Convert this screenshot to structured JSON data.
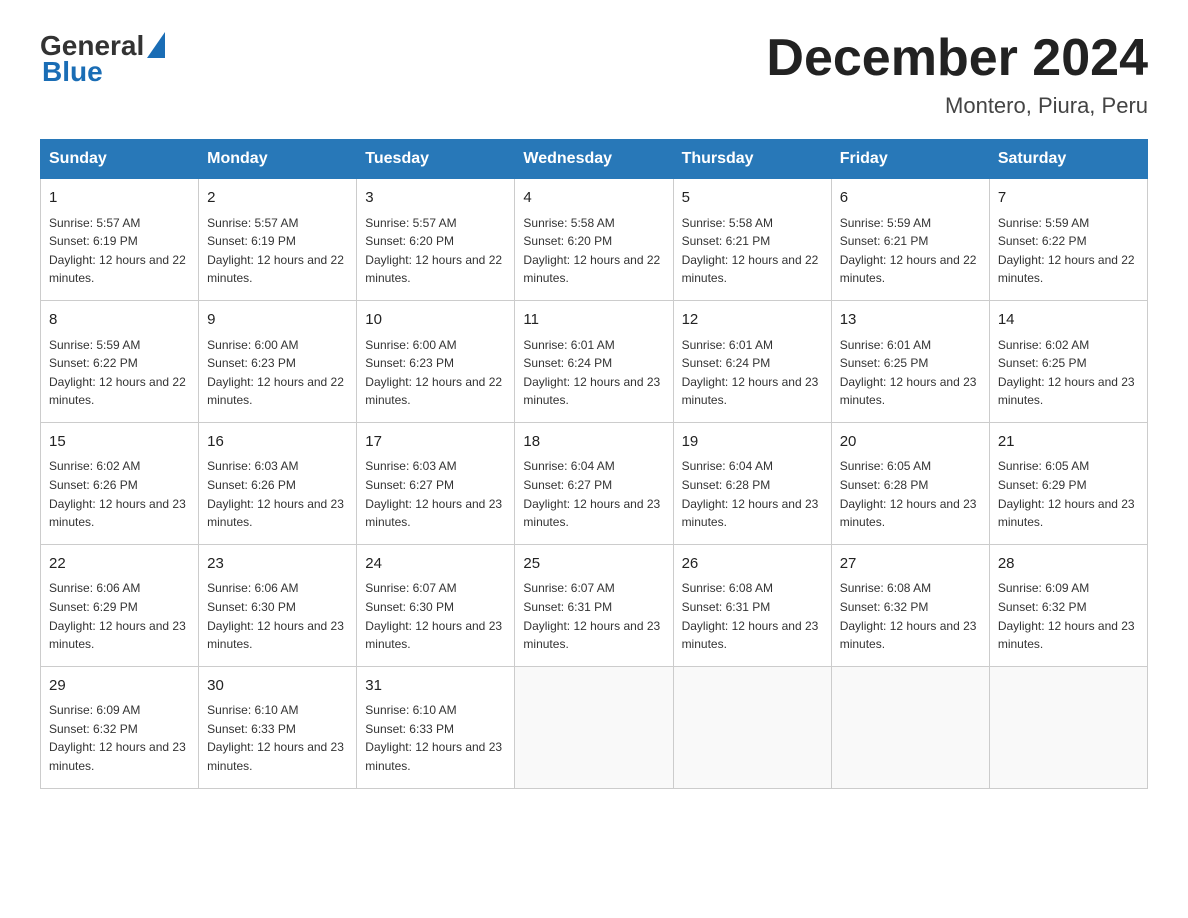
{
  "header": {
    "logo_general": "General",
    "logo_blue": "Blue",
    "month_title": "December 2024",
    "location": "Montero, Piura, Peru"
  },
  "calendar": {
    "weekdays": [
      "Sunday",
      "Monday",
      "Tuesday",
      "Wednesday",
      "Thursday",
      "Friday",
      "Saturday"
    ],
    "weeks": [
      [
        {
          "day": "1",
          "sunrise": "5:57 AM",
          "sunset": "6:19 PM",
          "daylight": "12 hours and 22 minutes."
        },
        {
          "day": "2",
          "sunrise": "5:57 AM",
          "sunset": "6:19 PM",
          "daylight": "12 hours and 22 minutes."
        },
        {
          "day": "3",
          "sunrise": "5:57 AM",
          "sunset": "6:20 PM",
          "daylight": "12 hours and 22 minutes."
        },
        {
          "day": "4",
          "sunrise": "5:58 AM",
          "sunset": "6:20 PM",
          "daylight": "12 hours and 22 minutes."
        },
        {
          "day": "5",
          "sunrise": "5:58 AM",
          "sunset": "6:21 PM",
          "daylight": "12 hours and 22 minutes."
        },
        {
          "day": "6",
          "sunrise": "5:59 AM",
          "sunset": "6:21 PM",
          "daylight": "12 hours and 22 minutes."
        },
        {
          "day": "7",
          "sunrise": "5:59 AM",
          "sunset": "6:22 PM",
          "daylight": "12 hours and 22 minutes."
        }
      ],
      [
        {
          "day": "8",
          "sunrise": "5:59 AM",
          "sunset": "6:22 PM",
          "daylight": "12 hours and 22 minutes."
        },
        {
          "day": "9",
          "sunrise": "6:00 AM",
          "sunset": "6:23 PM",
          "daylight": "12 hours and 22 minutes."
        },
        {
          "day": "10",
          "sunrise": "6:00 AM",
          "sunset": "6:23 PM",
          "daylight": "12 hours and 22 minutes."
        },
        {
          "day": "11",
          "sunrise": "6:01 AM",
          "sunset": "6:24 PM",
          "daylight": "12 hours and 23 minutes."
        },
        {
          "day": "12",
          "sunrise": "6:01 AM",
          "sunset": "6:24 PM",
          "daylight": "12 hours and 23 minutes."
        },
        {
          "day": "13",
          "sunrise": "6:01 AM",
          "sunset": "6:25 PM",
          "daylight": "12 hours and 23 minutes."
        },
        {
          "day": "14",
          "sunrise": "6:02 AM",
          "sunset": "6:25 PM",
          "daylight": "12 hours and 23 minutes."
        }
      ],
      [
        {
          "day": "15",
          "sunrise": "6:02 AM",
          "sunset": "6:26 PM",
          "daylight": "12 hours and 23 minutes."
        },
        {
          "day": "16",
          "sunrise": "6:03 AM",
          "sunset": "6:26 PM",
          "daylight": "12 hours and 23 minutes."
        },
        {
          "day": "17",
          "sunrise": "6:03 AM",
          "sunset": "6:27 PM",
          "daylight": "12 hours and 23 minutes."
        },
        {
          "day": "18",
          "sunrise": "6:04 AM",
          "sunset": "6:27 PM",
          "daylight": "12 hours and 23 minutes."
        },
        {
          "day": "19",
          "sunrise": "6:04 AM",
          "sunset": "6:28 PM",
          "daylight": "12 hours and 23 minutes."
        },
        {
          "day": "20",
          "sunrise": "6:05 AM",
          "sunset": "6:28 PM",
          "daylight": "12 hours and 23 minutes."
        },
        {
          "day": "21",
          "sunrise": "6:05 AM",
          "sunset": "6:29 PM",
          "daylight": "12 hours and 23 minutes."
        }
      ],
      [
        {
          "day": "22",
          "sunrise": "6:06 AM",
          "sunset": "6:29 PM",
          "daylight": "12 hours and 23 minutes."
        },
        {
          "day": "23",
          "sunrise": "6:06 AM",
          "sunset": "6:30 PM",
          "daylight": "12 hours and 23 minutes."
        },
        {
          "day": "24",
          "sunrise": "6:07 AM",
          "sunset": "6:30 PM",
          "daylight": "12 hours and 23 minutes."
        },
        {
          "day": "25",
          "sunrise": "6:07 AM",
          "sunset": "6:31 PM",
          "daylight": "12 hours and 23 minutes."
        },
        {
          "day": "26",
          "sunrise": "6:08 AM",
          "sunset": "6:31 PM",
          "daylight": "12 hours and 23 minutes."
        },
        {
          "day": "27",
          "sunrise": "6:08 AM",
          "sunset": "6:32 PM",
          "daylight": "12 hours and 23 minutes."
        },
        {
          "day": "28",
          "sunrise": "6:09 AM",
          "sunset": "6:32 PM",
          "daylight": "12 hours and 23 minutes."
        }
      ],
      [
        {
          "day": "29",
          "sunrise": "6:09 AM",
          "sunset": "6:32 PM",
          "daylight": "12 hours and 23 minutes."
        },
        {
          "day": "30",
          "sunrise": "6:10 AM",
          "sunset": "6:33 PM",
          "daylight": "12 hours and 23 minutes."
        },
        {
          "day": "31",
          "sunrise": "6:10 AM",
          "sunset": "6:33 PM",
          "daylight": "12 hours and 23 minutes."
        },
        null,
        null,
        null,
        null
      ]
    ]
  },
  "labels": {
    "sunrise_prefix": "Sunrise: ",
    "sunset_prefix": "Sunset: ",
    "daylight_prefix": "Daylight: "
  }
}
